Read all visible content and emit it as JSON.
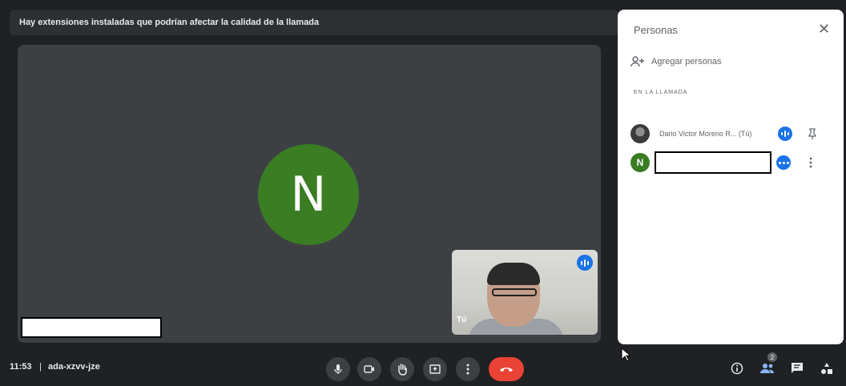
{
  "banner": {
    "text": "Hay extensiones instaladas que podrían afectar la calidad de la llamada"
  },
  "stage": {
    "avatar_letter": "N",
    "avatar_color": "#3a7d23"
  },
  "self_view": {
    "label": "Tú"
  },
  "people_panel": {
    "title": "Personas",
    "close_icon": "close-icon",
    "add_people_label": "Agregar personas",
    "section_header": "EN LA LLAMADA",
    "participants": [
      {
        "name": "Dario Victor Moreno R... (Tú)",
        "avatar": "photo",
        "status_icon": "speaking-icon",
        "action_icon": "pin-icon"
      },
      {
        "name": "",
        "avatar_letter": "N",
        "status_icon": "mic-dots-icon",
        "action_icon": "more-vert-icon"
      }
    ]
  },
  "bottom_bar": {
    "time": "11:53",
    "separator": "|",
    "meeting_code": "ada-xzvv-jze",
    "controls": [
      "mic-icon",
      "camera-icon",
      "raise-hand-icon",
      "present-icon",
      "more-vert-icon",
      "hang-up-icon"
    ],
    "right_controls": [
      "info-icon",
      "people-icon",
      "chat-icon",
      "activities-icon"
    ],
    "people_count": "2"
  },
  "colors": {
    "accent": "#1a73e8",
    "hangup": "#ea4335",
    "stage_bg": "#3c4043"
  }
}
